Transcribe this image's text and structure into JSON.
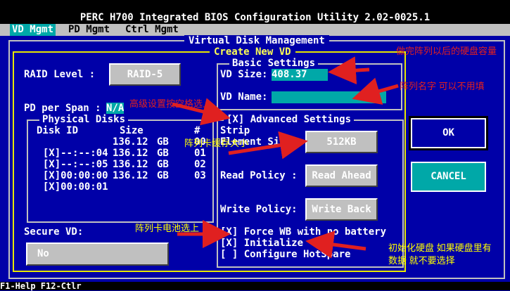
{
  "header": {
    "title": "PERC H700 Integrated BIOS Configuration Utility 2.02-0025.1"
  },
  "menu": [
    "VD Mgmt",
    "PD Mgmt",
    "Ctrl Mgmt"
  ],
  "panel": {
    "title": "Virtual Disk Management",
    "subtitle": "Create New VD"
  },
  "raid": {
    "label": "RAID Level :",
    "value": "RAID-5"
  },
  "pd_span": {
    "label": "PD per Span :",
    "value": "N/A"
  },
  "physical": {
    "title": "Physical Disks",
    "header": {
      "id": "Disk ID",
      "size": "Size",
      "num": "#"
    },
    "rows": [
      {
        "check": "[X]",
        "id": "--:--:04",
        "size": "136.12",
        "unit": "GB",
        "num": "00"
      },
      {
        "check": "[X]",
        "id": "--:--:05",
        "size": "136.12",
        "unit": "GB",
        "num": "01"
      },
      {
        "check": "[X]",
        "id": "00:00:00",
        "size": "136.12",
        "unit": "GB",
        "num": "02"
      },
      {
        "check": "[X]",
        "id": "00:00:01",
        "size": "136.12",
        "unit": "GB",
        "num": "03"
      }
    ]
  },
  "secure": {
    "label": "Secure VD:",
    "value": "No"
  },
  "basic": {
    "title": "Basic Settings",
    "size_label": "VD Size:",
    "size_value": "408.37",
    "size_unit": "GB",
    "name_label": "VD Name:",
    "name_value": ""
  },
  "advanced": {
    "title": "[X] Advanced Settings",
    "strip_label": "Strip",
    "element_label": "Element Size:",
    "element_value": "512KB",
    "read_label": "Read Policy :",
    "read_value": "Read Ahead",
    "write_label": "Write Policy:",
    "write_value": "Write Back",
    "force_wb": "[X] Force WB with no battery",
    "initialize": "[X] Initialize",
    "hotspare": "[ ] Configure HotSpare"
  },
  "buttons": {
    "ok": "OK",
    "cancel": "CANCEL"
  },
  "status": "F1-Help F12-Ctlr",
  "annotations": {
    "capacity": "做完阵列以后的硬盘容量",
    "name": "阵列名字  可以不用填",
    "advanced": "高级设置按空格选上",
    "stripe": "阵列卡缓存大小",
    "battery": "阵列卡电池选上",
    "init_1": "初始化硬盘  如果硬盘里有",
    "init_2": "数据  就不要选择"
  },
  "colors": {
    "background": "#0000a8",
    "annotation_red": "#e02020",
    "annotation_yellow": "#ffff00",
    "field_cyan": "#00a8a8"
  }
}
